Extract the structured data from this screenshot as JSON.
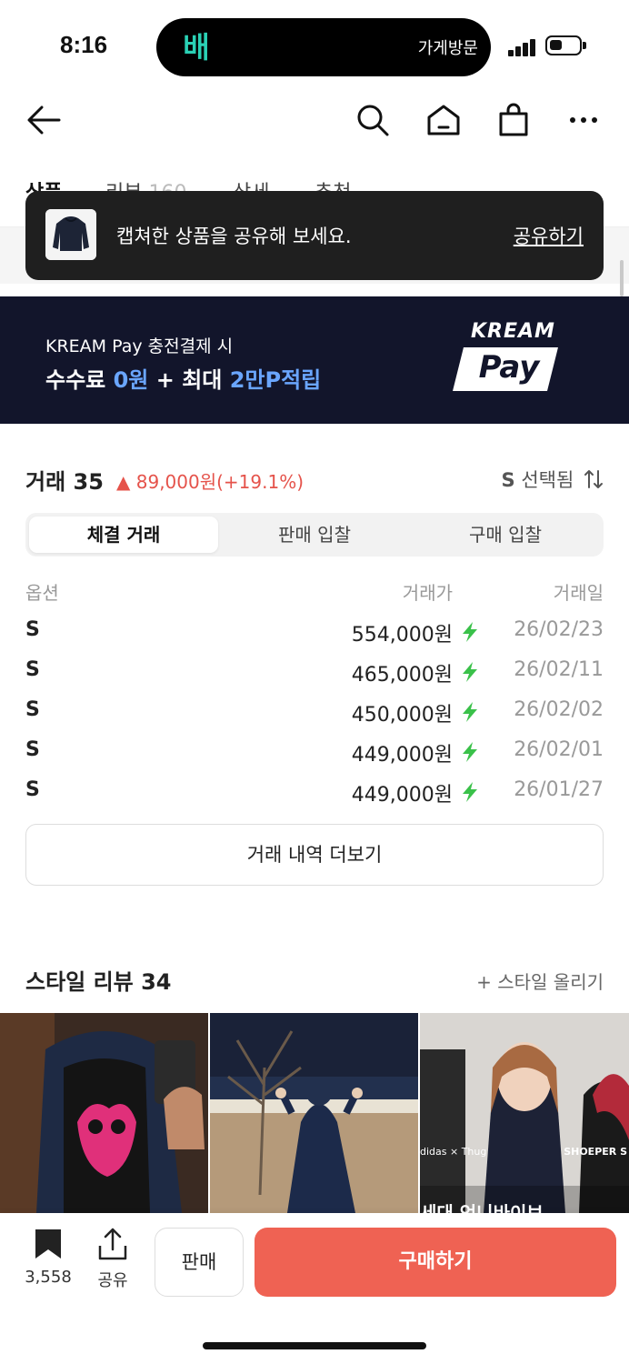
{
  "status": {
    "time": "8:16",
    "island_logo": "배",
    "island_text": "가게방문"
  },
  "nav": {
    "icons": [
      "back-arrow-icon",
      "search-icon",
      "home-icon",
      "bag-icon",
      "more-icon"
    ]
  },
  "tabs": [
    {
      "label": "상품",
      "active": true
    },
    {
      "label": "리뷰",
      "count": "160"
    },
    {
      "label": "상세"
    },
    {
      "label": "추천"
    }
  ],
  "toast": {
    "text": "캡쳐한 상품을 공유해 보세요.",
    "action": "공유하기"
  },
  "banner": {
    "line1": "KREAM Pay 충전결제 시",
    "line2_a": "수수료 ",
    "line2_b": "0원",
    "line2_c": " + 최대 ",
    "line2_d": "2만P적립",
    "brand": "KREAM",
    "pay": "Pay"
  },
  "trade": {
    "title": "거래 35",
    "change": "▲ 89,000원(+19.1%)",
    "option_size": "S",
    "option_label": " 선택됨",
    "sort_icon": "sort-icon",
    "segments": [
      "체결 거래",
      "판매 입찰",
      "구매 입찰"
    ],
    "active_segment": 0,
    "columns": [
      "옵션",
      "거래가",
      "거래일"
    ],
    "rows": [
      {
        "option": "S",
        "price": "554,000원",
        "date": "26/02/23"
      },
      {
        "option": "S",
        "price": "465,000원",
        "date": "26/02/11"
      },
      {
        "option": "S",
        "price": "450,000원",
        "date": "26/02/02"
      },
      {
        "option": "S",
        "price": "449,000원",
        "date": "26/02/01"
      },
      {
        "option": "S",
        "price": "449,000원",
        "date": "26/01/27"
      }
    ],
    "more_label": "거래 내역 더보기"
  },
  "style": {
    "title": "스타일 리뷰 34",
    "add_label": "+ 스타일 올리기",
    "photo3_left_text": "didas × Thug",
    "photo3_right_text": "SHOEPER S",
    "photo3_bottom_text": "세대 언니바이브"
  },
  "bottom": {
    "bookmark_count": "3,558",
    "share_label": "공유",
    "sell_label": "판매",
    "buy_label": "구매하기"
  },
  "colors": {
    "accent_red": "#ef6253",
    "price_change": "#e5534b",
    "bolt_green": "#3ac14a",
    "banner_bg": "#12152b",
    "banner_highlight": "#6aa6ff"
  }
}
